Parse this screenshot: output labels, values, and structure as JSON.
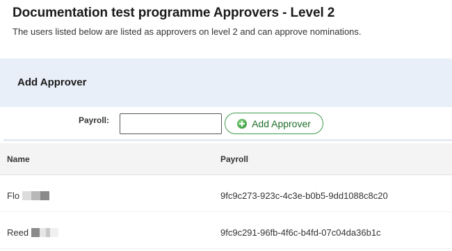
{
  "page": {
    "title": "Documentation test programme  Approvers - Level 2",
    "subtitle": "The users listed below are listed as approvers on level 2 and can approve nominations."
  },
  "add_approver": {
    "title": "Add Approver",
    "payroll_label": "Payroll:",
    "payroll_value": "",
    "button_label": "Add Approver",
    "button_icon": "plus-circle-icon"
  },
  "table": {
    "columns": [
      "Name",
      "Payroll"
    ],
    "rows": [
      {
        "name": "Flo",
        "payroll": "9fc9c273-923c-4c3e-b0b5-9dd1088c8c20"
      },
      {
        "name": "Reed",
        "payroll": "9fc9c291-96fb-4f6c-b4fd-07c04da36b1c"
      }
    ]
  },
  "colors": {
    "panel_bg": "#e8eff8",
    "button_border": "#3c9a4a",
    "button_text": "#1e6e2a",
    "header_bg": "#f4f4f4"
  }
}
